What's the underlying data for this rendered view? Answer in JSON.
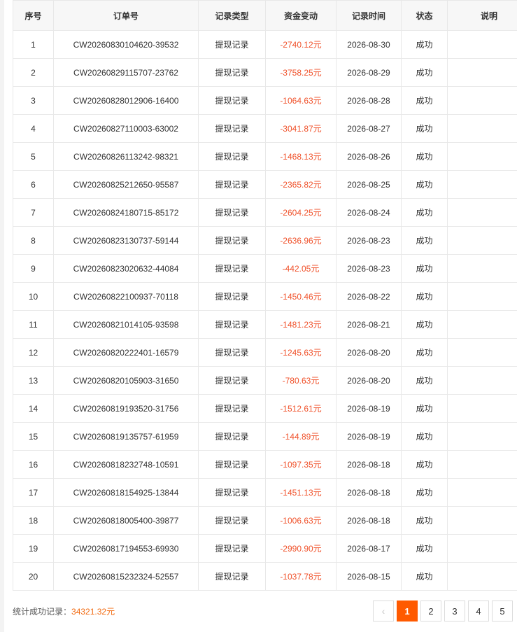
{
  "table": {
    "headers": [
      "序号",
      "订单号",
      "记录类型",
      "资金变动",
      "记录时间",
      "状态",
      "说明"
    ],
    "rows": [
      {
        "index": "1",
        "order": "CW20260830104620-39532",
        "type": "提现记录",
        "amount": "-2740.12元",
        "date": "2026-08-30",
        "status": "成功",
        "note": ""
      },
      {
        "index": "2",
        "order": "CW20260829115707-23762",
        "type": "提现记录",
        "amount": "-3758.25元",
        "date": "2026-08-29",
        "status": "成功",
        "note": ""
      },
      {
        "index": "3",
        "order": "CW20260828012906-16400",
        "type": "提现记录",
        "amount": "-1064.63元",
        "date": "2026-08-28",
        "status": "成功",
        "note": ""
      },
      {
        "index": "4",
        "order": "CW20260827110003-63002",
        "type": "提现记录",
        "amount": "-3041.87元",
        "date": "2026-08-27",
        "status": "成功",
        "note": ""
      },
      {
        "index": "5",
        "order": "CW20260826113242-98321",
        "type": "提现记录",
        "amount": "-1468.13元",
        "date": "2026-08-26",
        "status": "成功",
        "note": ""
      },
      {
        "index": "6",
        "order": "CW20260825212650-95587",
        "type": "提现记录",
        "amount": "-2365.82元",
        "date": "2026-08-25",
        "status": "成功",
        "note": ""
      },
      {
        "index": "7",
        "order": "CW20260824180715-85172",
        "type": "提现记录",
        "amount": "-2604.25元",
        "date": "2026-08-24",
        "status": "成功",
        "note": ""
      },
      {
        "index": "8",
        "order": "CW20260823130737-59144",
        "type": "提现记录",
        "amount": "-2636.96元",
        "date": "2026-08-23",
        "status": "成功",
        "note": ""
      },
      {
        "index": "9",
        "order": "CW20260823020632-44084",
        "type": "提现记录",
        "amount": "-442.05元",
        "date": "2026-08-23",
        "status": "成功",
        "note": ""
      },
      {
        "index": "10",
        "order": "CW20260822100937-70118",
        "type": "提现记录",
        "amount": "-1450.46元",
        "date": "2026-08-22",
        "status": "成功",
        "note": ""
      },
      {
        "index": "11",
        "order": "CW20260821014105-93598",
        "type": "提现记录",
        "amount": "-1481.23元",
        "date": "2026-08-21",
        "status": "成功",
        "note": ""
      },
      {
        "index": "12",
        "order": "CW20260820222401-16579",
        "type": "提现记录",
        "amount": "-1245.63元",
        "date": "2026-08-20",
        "status": "成功",
        "note": ""
      },
      {
        "index": "13",
        "order": "CW20260820105903-31650",
        "type": "提现记录",
        "amount": "-780.63元",
        "date": "2026-08-20",
        "status": "成功",
        "note": ""
      },
      {
        "index": "14",
        "order": "CW20260819193520-31756",
        "type": "提现记录",
        "amount": "-1512.61元",
        "date": "2026-08-19",
        "status": "成功",
        "note": ""
      },
      {
        "index": "15",
        "order": "CW20260819135757-61959",
        "type": "提现记录",
        "amount": "-144.89元",
        "date": "2026-08-19",
        "status": "成功",
        "note": ""
      },
      {
        "index": "16",
        "order": "CW20260818232748-10591",
        "type": "提现记录",
        "amount": "-1097.35元",
        "date": "2026-08-18",
        "status": "成功",
        "note": ""
      },
      {
        "index": "17",
        "order": "CW20260818154925-13844",
        "type": "提现记录",
        "amount": "-1451.13元",
        "date": "2026-08-18",
        "status": "成功",
        "note": ""
      },
      {
        "index": "18",
        "order": "CW20260818005400-39877",
        "type": "提现记录",
        "amount": "-1006.63元",
        "date": "2026-08-18",
        "status": "成功",
        "note": ""
      },
      {
        "index": "19",
        "order": "CW20260817194553-69930",
        "type": "提现记录",
        "amount": "-2990.90元",
        "date": "2026-08-17",
        "status": "成功",
        "note": ""
      },
      {
        "index": "20",
        "order": "CW20260815232324-52557",
        "type": "提现记录",
        "amount": "-1037.78元",
        "date": "2026-08-15",
        "status": "成功",
        "note": ""
      }
    ]
  },
  "summary": {
    "label": "统计成功记录：",
    "total": "34321.32元"
  },
  "pagination": {
    "prev_icon": "chevron-left-icon",
    "prev_glyph": "‹",
    "pages": [
      "1",
      "2",
      "3",
      "4",
      "5"
    ],
    "current_page": "1"
  },
  "colors": {
    "amount_negative": "#f0522b",
    "summary_total": "#f26b12",
    "active_page": "#ff5a00",
    "header_bg": "#f7f7f7",
    "border": "#e8e8e8"
  }
}
